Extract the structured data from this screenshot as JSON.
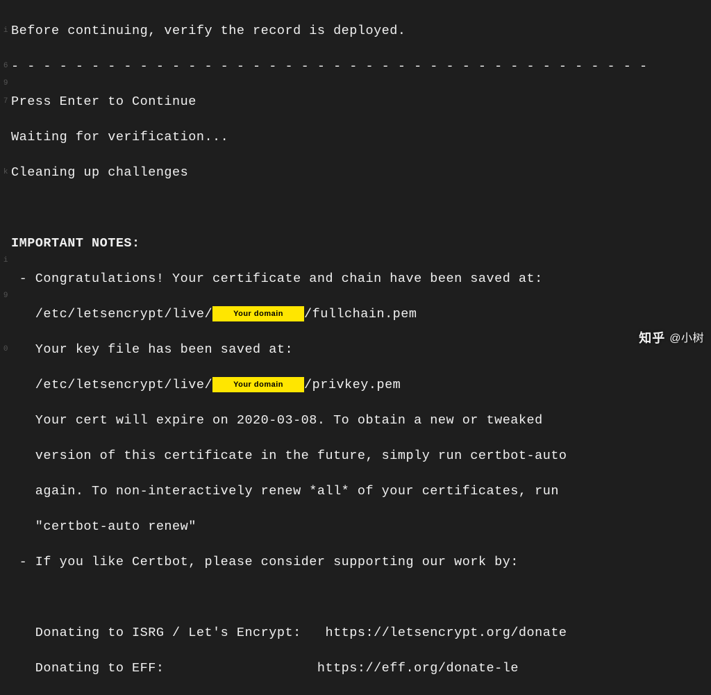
{
  "gutter": [
    "",
    "i",
    "",
    "6",
    "9",
    "7",
    "",
    "",
    "",
    "k",
    "",
    "",
    "",
    "",
    "i",
    "",
    "9",
    "",
    "",
    "0"
  ],
  "lines": {
    "before_continue": "Before continuing, verify the record is deployed.",
    "dash_row": "- - - - - - - - - - - - - - - - - - - - - - - - - - - - - - - - - - - - - - - -",
    "press_enter": "Press Enter to Continue",
    "waiting": "Waiting for verification...",
    "cleaning": "Cleaning up challenges",
    "important": "IMPORTANT NOTES:",
    "congrats": " - Congratulations! Your certificate and chain have been saved at:",
    "fullchain_prefix": "   /etc/letsencrypt/live/",
    "fullchain_suffix": "/fullchain.pem",
    "key_saved": "   Your key file has been saved at:",
    "privkey_prefix": "   /etc/letsencrypt/live/",
    "privkey_suffix": "/privkey.pem",
    "expire1": "   Your cert will expire on 2020-03-08. To obtain a new or tweaked",
    "expire2": "   version of this certificate in the future, simply run certbot-auto",
    "expire3": "   again. To non-interactively renew *all* of your certificates, run",
    "expire4": "   \"certbot-auto renew\"",
    "like_certbot": " - If you like Certbot, please consider supporting our work by:",
    "donate1_label": "   Donating to ISRG / Let's Encrypt:",
    "donate1_url": "   https://letsencrypt.org/donate",
    "donate2_label": "   Donating to EFF:",
    "donate2_url": "                   https://eff.org/donate-le"
  },
  "redaction": {
    "label": "Your domain"
  },
  "watermark": {
    "logo": "知乎",
    "handle": "@小树"
  }
}
